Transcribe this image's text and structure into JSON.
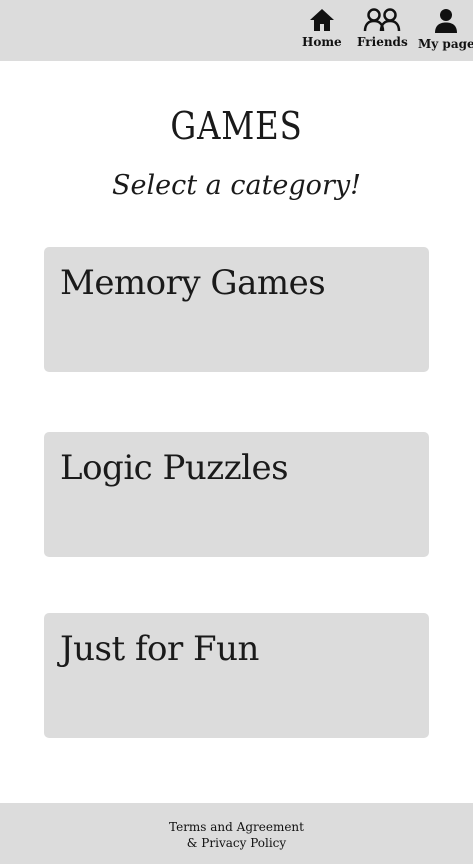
{
  "nav": {
    "items": [
      {
        "label": "Home",
        "icon": "home-icon"
      },
      {
        "label": "Friends",
        "icon": "friends-icon"
      },
      {
        "label": "My page",
        "icon": "user-icon"
      }
    ]
  },
  "header": {
    "title": "GAMES",
    "subtitle": "Select a category!"
  },
  "categories": [
    {
      "label": "Memory Games"
    },
    {
      "label": "Logic Puzzles"
    },
    {
      "label": "Just for Fun"
    }
  ],
  "footer": {
    "line1": "Terms and Agreement",
    "line2": "& Privacy Policy"
  },
  "colors": {
    "bar_background": "#dcdcdc",
    "card_background": "#dcdcdc",
    "page_background": "#ffffff",
    "text": "#1a1a1a"
  }
}
